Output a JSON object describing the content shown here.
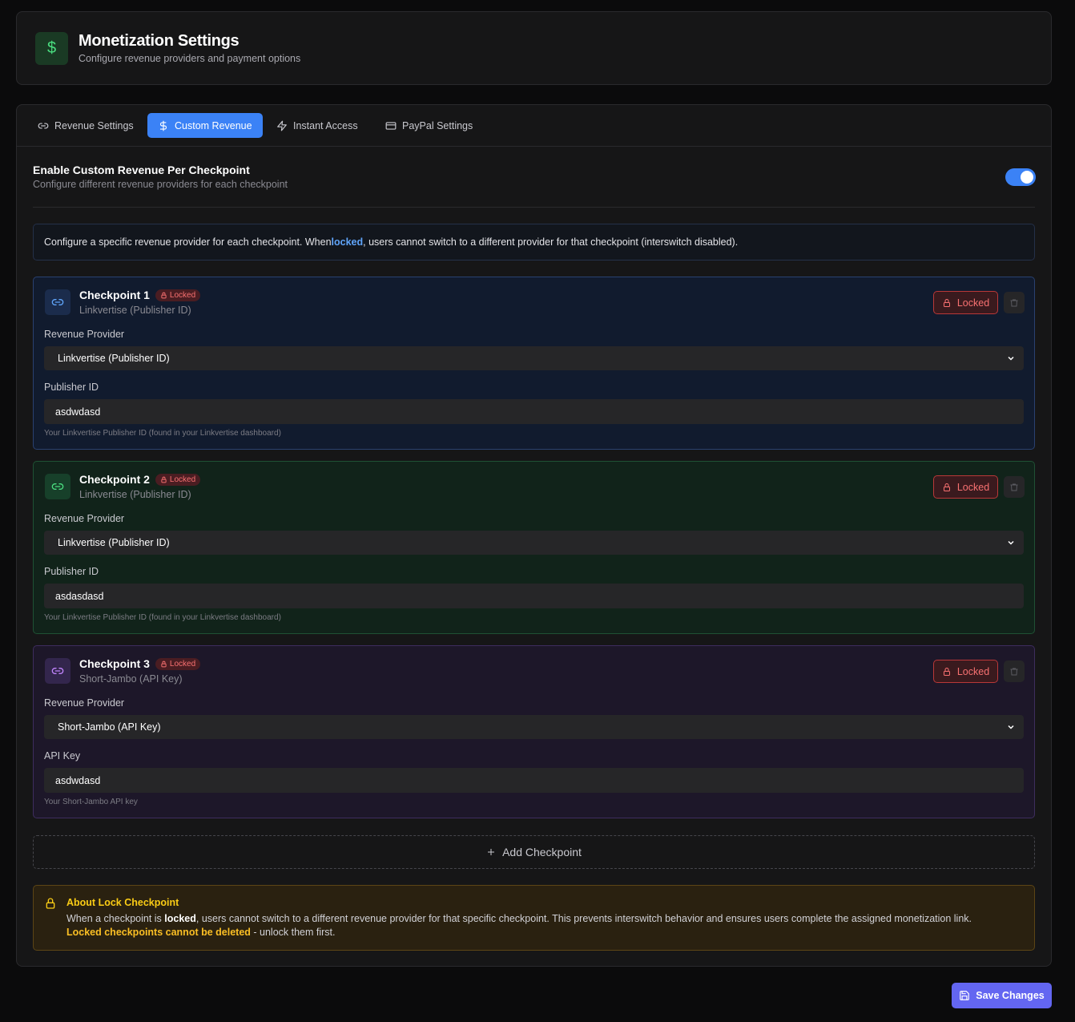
{
  "header": {
    "icon": "dollar-icon",
    "title": "Monetization Settings",
    "subtitle": "Configure revenue providers and payment options"
  },
  "tabs": [
    {
      "label": "Revenue Settings",
      "icon": "link-icon",
      "active": false
    },
    {
      "label": "Custom Revenue",
      "icon": "dollar-icon",
      "active": true
    },
    {
      "label": "Instant Access",
      "icon": "zap-icon",
      "active": false
    },
    {
      "label": "PayPal Settings",
      "icon": "credit-card-icon",
      "active": false
    }
  ],
  "custom_revenue": {
    "title": "Enable Custom Revenue Per Checkpoint",
    "subtitle": "Configure different revenue providers for each checkpoint",
    "enabled": true
  },
  "info": {
    "before": "Configure a specific revenue provider for each checkpoint. When ",
    "highlight": "locked",
    "after": ", users cannot switch to a different provider for that checkpoint (interswitch disabled)."
  },
  "checkpoints": [
    {
      "title": "Checkpoint 1",
      "badge": "Locked",
      "subtitle": "Linkvertise (Publisher ID)",
      "lock_button": "Locked",
      "provider_label": "Revenue Provider",
      "provider_value": "Linkvertise (Publisher ID)",
      "field_label": "Publisher ID",
      "field_value": "asdwdasd",
      "hint": "Your Linkvertise Publisher ID (found in your Linkvertise dashboard)",
      "color": "#3b82f6"
    },
    {
      "title": "Checkpoint 2",
      "badge": "Locked",
      "subtitle": "Linkvertise (Publisher ID)",
      "lock_button": "Locked",
      "provider_label": "Revenue Provider",
      "provider_value": "Linkvertise (Publisher ID)",
      "field_label": "Publisher ID",
      "field_value": "asdasdasd",
      "hint": "Your Linkvertise Publisher ID (found in your Linkvertise dashboard)",
      "color": "#22c55e"
    },
    {
      "title": "Checkpoint 3",
      "badge": "Locked",
      "subtitle": "Short-Jambo (API Key)",
      "lock_button": "Locked",
      "provider_label": "Revenue Provider",
      "provider_value": "Short-Jambo (API Key)",
      "field_label": "API Key",
      "field_value": "asdwdasd",
      "hint": "Your Short-Jambo API key",
      "color": "#a855f7"
    }
  ],
  "add_checkpoint": "Add Checkpoint",
  "about": {
    "title": "About Lock Checkpoint",
    "line1_a": "When a checkpoint is ",
    "line1_b": "locked",
    "line1_c": ", users cannot switch to a different revenue provider for that specific checkpoint. This prevents interswitch behavior and ensures users complete the assigned monetization link.",
    "line2_warn": "Locked checkpoints cannot be deleted",
    "line2_rest": " - unlock them first."
  },
  "save_button": "Save Changes"
}
